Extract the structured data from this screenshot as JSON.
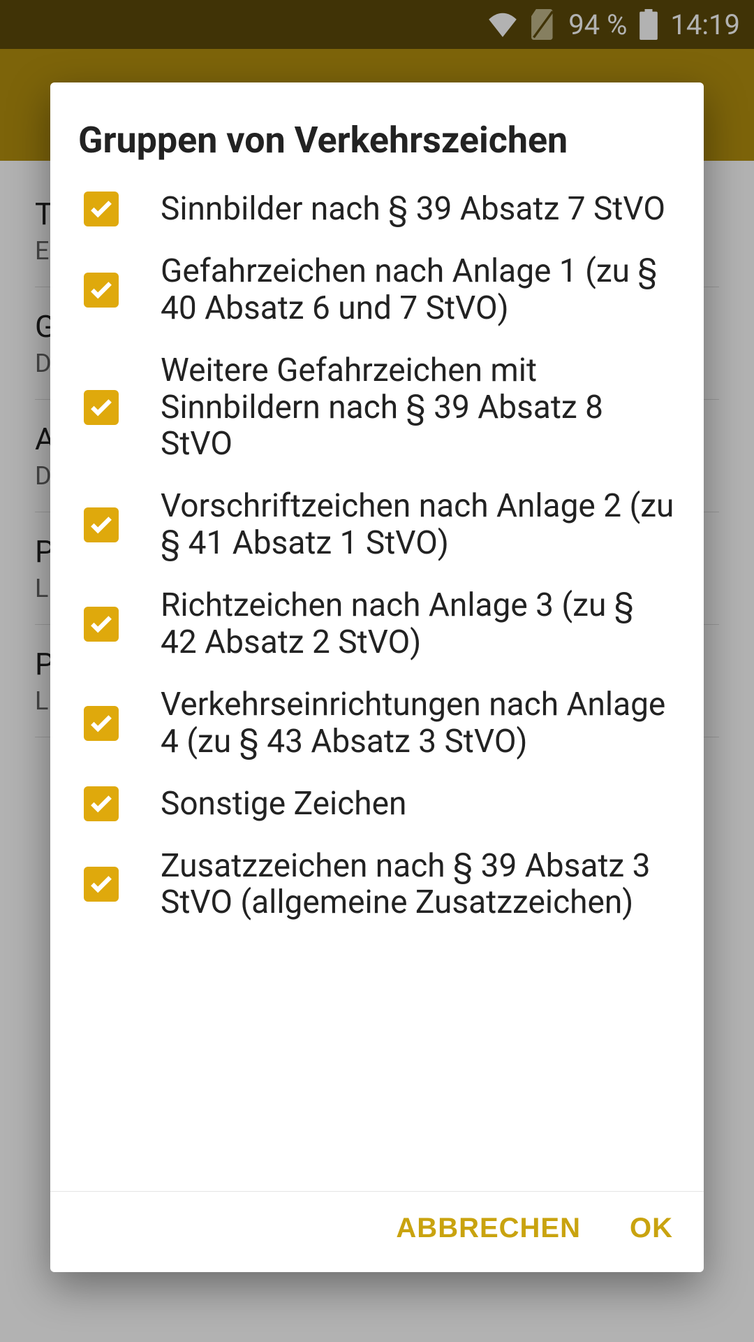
{
  "status": {
    "battery_pct": "94 %",
    "time": "14:19"
  },
  "background": {
    "items": [
      {
        "title": "T…",
        "sub": "E…"
      },
      {
        "title": "G…",
        "sub": "D…"
      },
      {
        "title": "A…",
        "sub": "D…\nA…"
      },
      {
        "title": "P…",
        "sub": "L…\ne…"
      },
      {
        "title": "P…",
        "sub": "L…\ne…"
      }
    ]
  },
  "dialog": {
    "title": "Gruppen von Verkehrszeichen",
    "options": [
      {
        "checked": true,
        "label": "Sinnbilder nach § 39 Absatz 7 StVO"
      },
      {
        "checked": true,
        "label": "Gefahrzeichen nach Anlage 1 (zu § 40 Absatz 6 und 7 StVO)"
      },
      {
        "checked": true,
        "label": "Weitere Gefahrzeichen mit Sinnbildern nach § 39 Absatz 8 StVO"
      },
      {
        "checked": true,
        "label": "Vorschriftzeichen nach Anlage 2 (zu § 41 Absatz 1 StVO)"
      },
      {
        "checked": true,
        "label": "Richtzeichen nach Anlage 3 (zu § 42 Absatz 2 StVO)"
      },
      {
        "checked": true,
        "label": "Verkehrseinrichtungen nach Anlage 4 (zu § 43 Absatz 3 StVO)"
      },
      {
        "checked": true,
        "label": "Sonstige Zeichen"
      },
      {
        "checked": true,
        "label": "Zusatzzeichen nach § 39 Absatz 3 StVO (allgemeine Zusatzzeichen)"
      }
    ],
    "cancel": "ABBRECHEN",
    "ok": "OK"
  }
}
